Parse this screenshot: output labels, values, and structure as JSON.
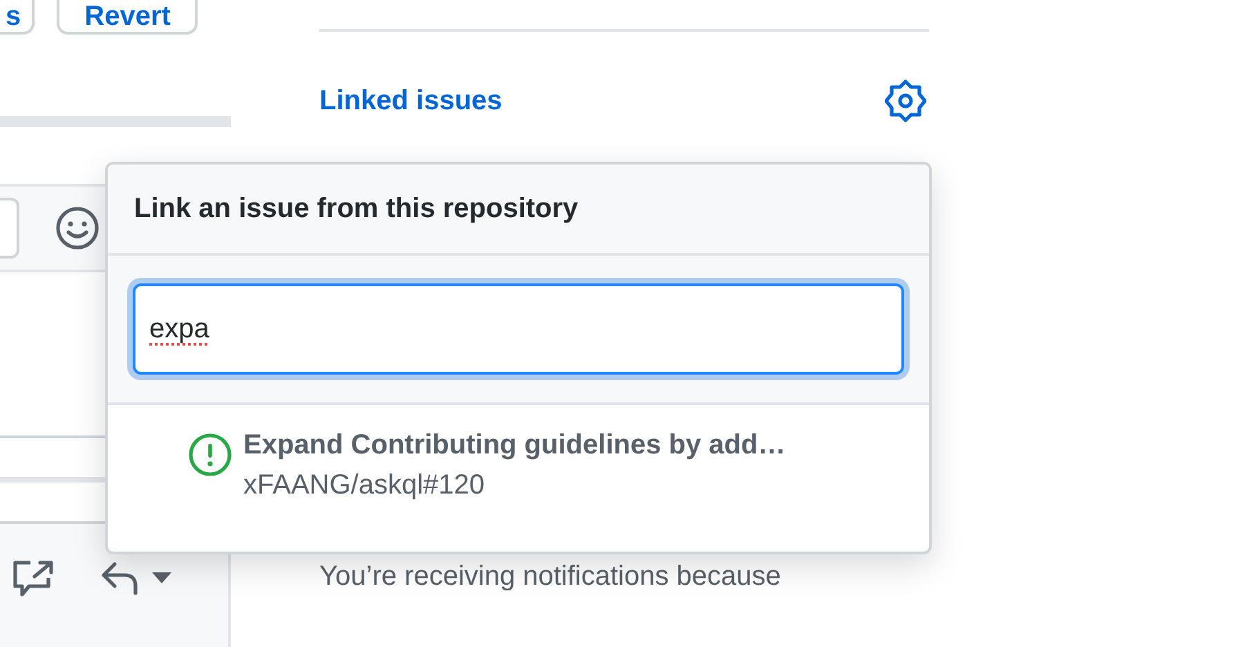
{
  "top_buttons": [
    {
      "label": "s"
    },
    {
      "label": "Revert"
    }
  ],
  "sidebar": {
    "section_title": "Linked issues",
    "notice": "You’re receiving notifications because"
  },
  "popup": {
    "title": "Link an issue from this repository",
    "search": {
      "value": "expa",
      "spelling_error": true
    },
    "results": [
      {
        "title": "Expand Contributing guidelines by add…",
        "reference": "xFAANG/askql#120",
        "color": "#28a745"
      }
    ]
  }
}
